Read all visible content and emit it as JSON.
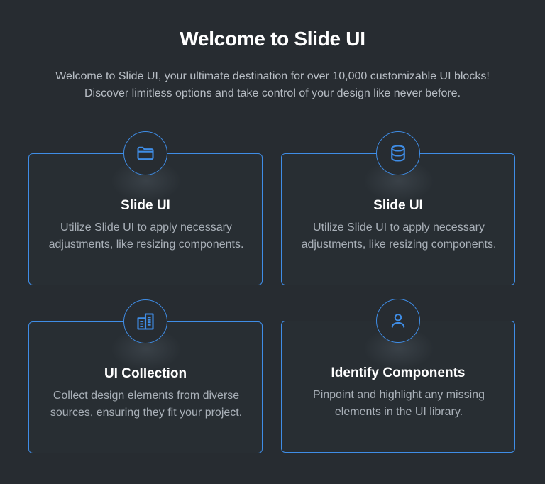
{
  "header": {
    "title": "Welcome to Slide UI",
    "subtitle": "Welcome to Slide UI, your ultimate destination for over 10,000 customizable UI blocks! Discover limitless options and take control of your design like never before."
  },
  "colors": {
    "background": "#272c31",
    "accent": "#3f8de6",
    "title": "#ffffff",
    "text": "#a9b0b8"
  },
  "cards": [
    {
      "icon": "folder-icon",
      "title": "Slide UI",
      "description": "Utilize Slide UI to apply necessary adjustments, like resizing components."
    },
    {
      "icon": "database-icon",
      "title": "Slide UI",
      "description": "Utilize Slide UI to apply necessary adjustments, like resizing components."
    },
    {
      "icon": "building-icon",
      "title": "UI Collection",
      "description": "Collect design elements from diverse sources, ensuring they fit your project."
    },
    {
      "icon": "user-icon",
      "title": "Identify Components",
      "description": "Pinpoint and highlight any missing elements in the UI library."
    }
  ]
}
